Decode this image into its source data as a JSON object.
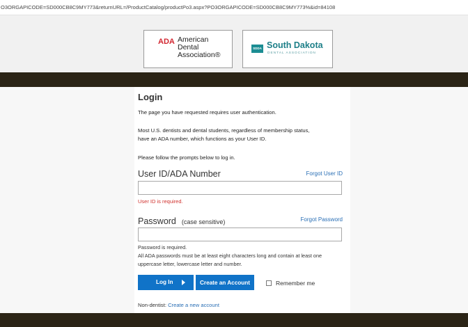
{
  "browser": {
    "url": "O3ORGAPICODE=SD000CB8C9MY773&returnURL=/ProductCatalog/productPo3.aspx?PO3ORGAPICODE=SD000CB8C9MY773%&id=84108"
  },
  "header": {
    "ada_logo": {
      "mark": "ADA",
      "line1": "American",
      "line2": "Dental",
      "line3": "Association®"
    },
    "sd_logo": {
      "icon_text": "SDDA",
      "name": "South Dakota",
      "subtitle": "DENTAL ASSOCIATION"
    }
  },
  "login": {
    "title": "Login",
    "auth_notice": "The page you have requested requires user authentication.",
    "info_line1": "Most U.S. dentists and dental students, regardless of membership status,",
    "info_line2": "have an ADA number, which functions as your User ID.",
    "prompt": "Please follow the prompts below to log in.",
    "user_label": "User ID/ADA Number",
    "forgot_user": "Forgot User ID",
    "user_value": "",
    "user_error": "User ID is required.",
    "password_label": "Password",
    "password_hint": "(case sensitive)",
    "forgot_password": "Forgot Password",
    "password_value": "",
    "password_error": "Password is required.",
    "password_rules_line1": "All ADA passwords must be at least eight characters long and contain at least one",
    "password_rules_line2": "uppercase letter, lowercase letter and number.",
    "login_button": "Log In",
    "create_account_button": "Create an Account",
    "remember_me": "Remember me",
    "remember_checked": false,
    "non_dentist_prefix": "Non-dentist:",
    "non_dentist_link": "Create a new account"
  },
  "colors": {
    "dark_bar": "#2b2416",
    "button_blue": "#1073c8",
    "link_blue": "#2a6fb5",
    "error_red": "#d0312d",
    "ada_red": "#d22630",
    "sd_teal": "#1d7f88"
  }
}
